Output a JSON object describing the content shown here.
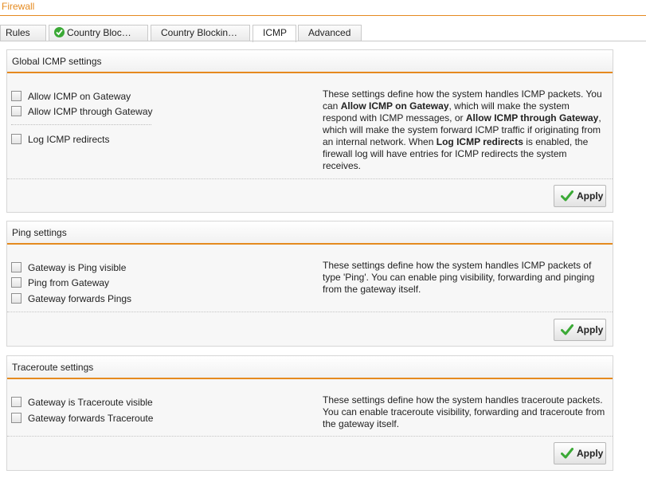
{
  "app": {
    "title": "Firewall"
  },
  "tabs": [
    {
      "label": "Rules",
      "active": false
    },
    {
      "label": "Country Bloc…",
      "active": false,
      "icon": "ok-check-icon"
    },
    {
      "label": "Country Blockin…",
      "active": false
    },
    {
      "label": "ICMP",
      "active": true
    },
    {
      "label": "Advanced",
      "active": false
    }
  ],
  "panels": {
    "global": {
      "title": "Global ICMP settings",
      "options": [
        {
          "label": "Allow ICMP on Gateway",
          "checked": false
        },
        {
          "label": "Allow ICMP through Gateway",
          "checked": false
        },
        {
          "label": "Log ICMP redirects",
          "checked": false
        }
      ],
      "desc": {
        "p1": "These settings define how the system handles ICMP packets. You can ",
        "b1": "Allow ICMP on Gateway",
        "p2": ", which will make the system respond with ICMP messages, or ",
        "b2": "Allow ICMP through Gateway",
        "p3": ", which will make the system forward ICMP traffic if originating from an internal network. When ",
        "b3": "Log ICMP redirects",
        "p4": " is enabled, the firewall log will have entries for ICMP redirects the system receives."
      },
      "apply_label": "Apply"
    },
    "ping": {
      "title": "Ping settings",
      "options": [
        {
          "label": "Gateway is Ping visible",
          "checked": false
        },
        {
          "label": "Ping from Gateway",
          "checked": false
        },
        {
          "label": "Gateway forwards Pings",
          "checked": false
        }
      ],
      "desc": "These settings define how the system handles ICMP packets of type 'Ping'. You can enable ping visibility, forwarding and pinging from the gateway itself.",
      "apply_label": "Apply"
    },
    "traceroute": {
      "title": "Traceroute settings",
      "options": [
        {
          "label": "Gateway is Traceroute visible",
          "checked": false
        },
        {
          "label": "Gateway forwards Traceroute",
          "checked": false
        }
      ],
      "desc": "These settings define how the system handles traceroute packets. You can enable traceroute visibility, forwarding and traceroute from the gateway itself.",
      "apply_label": "Apply"
    }
  },
  "colors": {
    "accent": "#e58a1f",
    "ok_green": "#3aa935"
  }
}
